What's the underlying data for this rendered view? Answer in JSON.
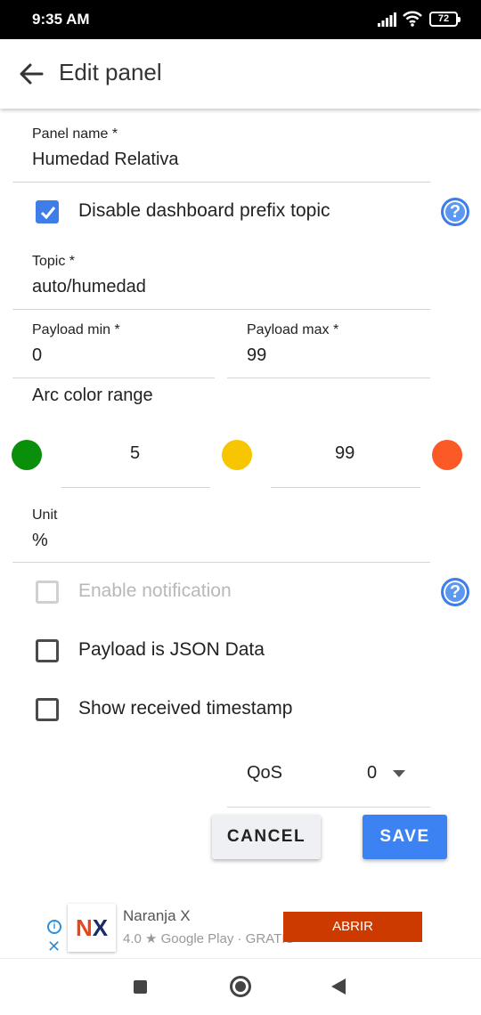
{
  "status_bar": {
    "time": "9:35 AM",
    "battery": "72"
  },
  "app_bar": {
    "title": "Edit panel"
  },
  "form": {
    "panel_name": {
      "label": "Panel name *",
      "value": "Humedad Relativa"
    },
    "disable_prefix": {
      "label": "Disable dashboard prefix topic",
      "checked": true
    },
    "topic": {
      "label": "Topic *",
      "value": "auto/humedad"
    },
    "payload_min": {
      "label": "Payload min *",
      "value": "0"
    },
    "payload_max": {
      "label": "Payload max *",
      "value": "99"
    },
    "arc_color_range": {
      "label": "Arc color range",
      "value_1": "5",
      "value_2": "99",
      "colors": [
        "#0a8f0a",
        "#f7c600",
        "#fb5a26"
      ]
    },
    "unit": {
      "label": "Unit",
      "value": "%"
    },
    "enable_notification": {
      "label": "Enable notification",
      "checked": false,
      "disabled": true
    },
    "payload_json": {
      "label": "Payload is JSON Data",
      "checked": false
    },
    "show_timestamp": {
      "label": "Show received timestamp",
      "checked": false
    },
    "qos": {
      "label": "QoS",
      "value": "0"
    }
  },
  "buttons": {
    "cancel": "CANCEL",
    "save": "SAVE"
  },
  "ad": {
    "logo_text_1": "N",
    "logo_text_2": "X",
    "title": "Naranja X",
    "subtitle": "4.0 ★ Google Play · GRATIS",
    "open_label": "ABRIR"
  },
  "colors": {
    "accent": "#3f7ee8",
    "save_button": "#3d82f2",
    "ad_button": "#cc3a00"
  }
}
